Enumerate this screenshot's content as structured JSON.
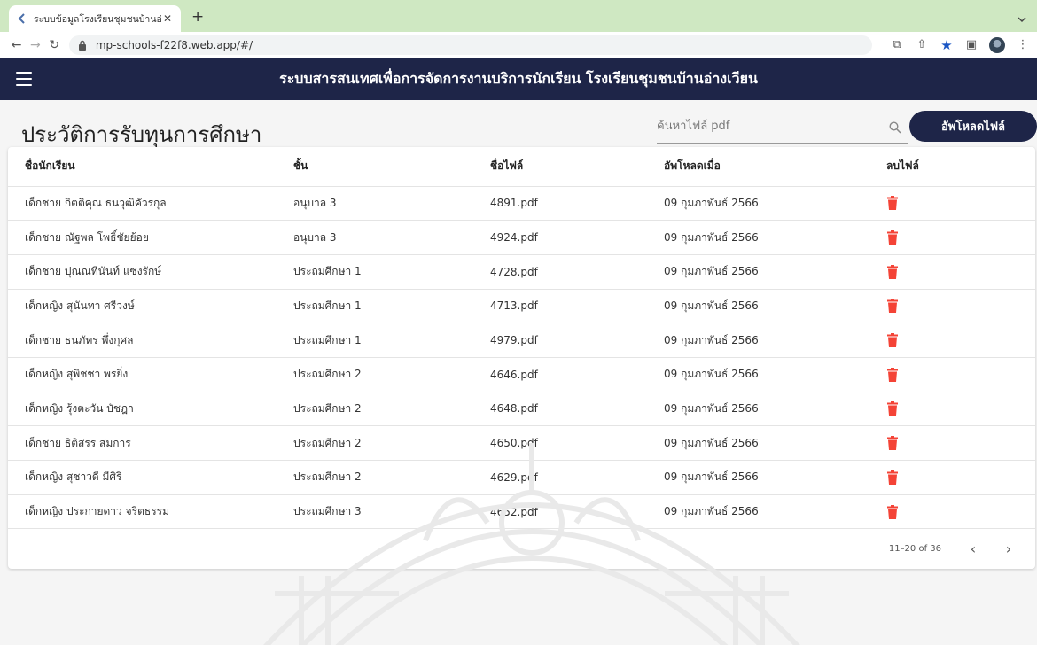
{
  "browser": {
    "tab_title": "ระบบข้อมูลโรงเรียนชุมชนบ้านอ่างเวี",
    "url": "mp-schools-f22f8.web.app/#/"
  },
  "app": {
    "title": "ระบบสารสนเทศเพื่อการจัดการงานบริการนักเรียน โรงเรียนชุมชนบ้านอ่างเวียน"
  },
  "page": {
    "title": "ประวัติการรับทุนการศึกษา",
    "search_placeholder": "ค้นหาไฟล์ pdf",
    "upload_label": "อัพโหลดไฟล์"
  },
  "table": {
    "headers": [
      "ชื่อนักเรียน",
      "ชั้น",
      "ชื่อไฟล์",
      "อัพโหลดเมื่อ",
      "ลบไฟล์"
    ],
    "rows": [
      {
        "name": "เด็กชาย กิตติคุณ ธนวุฒิคัวรกุล",
        "grade": "อนุบาล 3",
        "file": "4891.pdf",
        "date": "09 กุมภาพันธ์ 2566"
      },
      {
        "name": "เด็กชาย ณัฐพล โพธิ์ชัยย้อย",
        "grade": "อนุบาล 3",
        "file": "4924.pdf",
        "date": "09 กุมภาพันธ์ 2566"
      },
      {
        "name": "เด็กชาย ปุณณทีนันท์ แซงรักษ์",
        "grade": "ประถมศึกษา 1",
        "file": "4728.pdf",
        "date": "09 กุมภาพันธ์ 2566"
      },
      {
        "name": "เด็กหญิง สุนันทา ศรีวงษ์",
        "grade": "ประถมศึกษา 1",
        "file": "4713.pdf",
        "date": "09 กุมภาพันธ์ 2566"
      },
      {
        "name": "เด็กชาย ธนภัทร พึ่งกุศล",
        "grade": "ประถมศึกษา 1",
        "file": "4979.pdf",
        "date": "09 กุมภาพันธ์ 2566"
      },
      {
        "name": "เด็กหญิง สุพิชชา พรยิ่ง",
        "grade": "ประถมศึกษา 2",
        "file": "4646.pdf",
        "date": "09 กุมภาพันธ์ 2566"
      },
      {
        "name": "เด็กหญิง รุ้งตะวัน บัชฎา",
        "grade": "ประถมศึกษา 2",
        "file": "4648.pdf",
        "date": "09 กุมภาพันธ์ 2566"
      },
      {
        "name": "เด็กชาย ธิติสรร สมการ",
        "grade": "ประถมศึกษา 2",
        "file": "4650.pdf",
        "date": "09 กุมภาพันธ์ 2566"
      },
      {
        "name": "เด็กหญิง สุชาวดี มีศิริ",
        "grade": "ประถมศึกษา 2",
        "file": "4629.pdf",
        "date": "09 กุมภาพันธ์ 2566"
      },
      {
        "name": "เด็กหญิง ประกายดาว จริตธรรม",
        "grade": "ประถมศึกษา 3",
        "file": "4652.pdf",
        "date": "09 กุมภาพันธ์ 2566"
      }
    ]
  },
  "paginator": {
    "range_label": "11–20 of 36"
  },
  "icons": {
    "menu": "hamburger-menu-icon",
    "search": "search-icon",
    "delete": "trash-icon",
    "prev": "chevron-left-icon",
    "next": "chevron-right-icon"
  },
  "colors": {
    "appbar": "#1e2548",
    "delete": "#f44336",
    "tabstrip": "#cfe8c2"
  }
}
